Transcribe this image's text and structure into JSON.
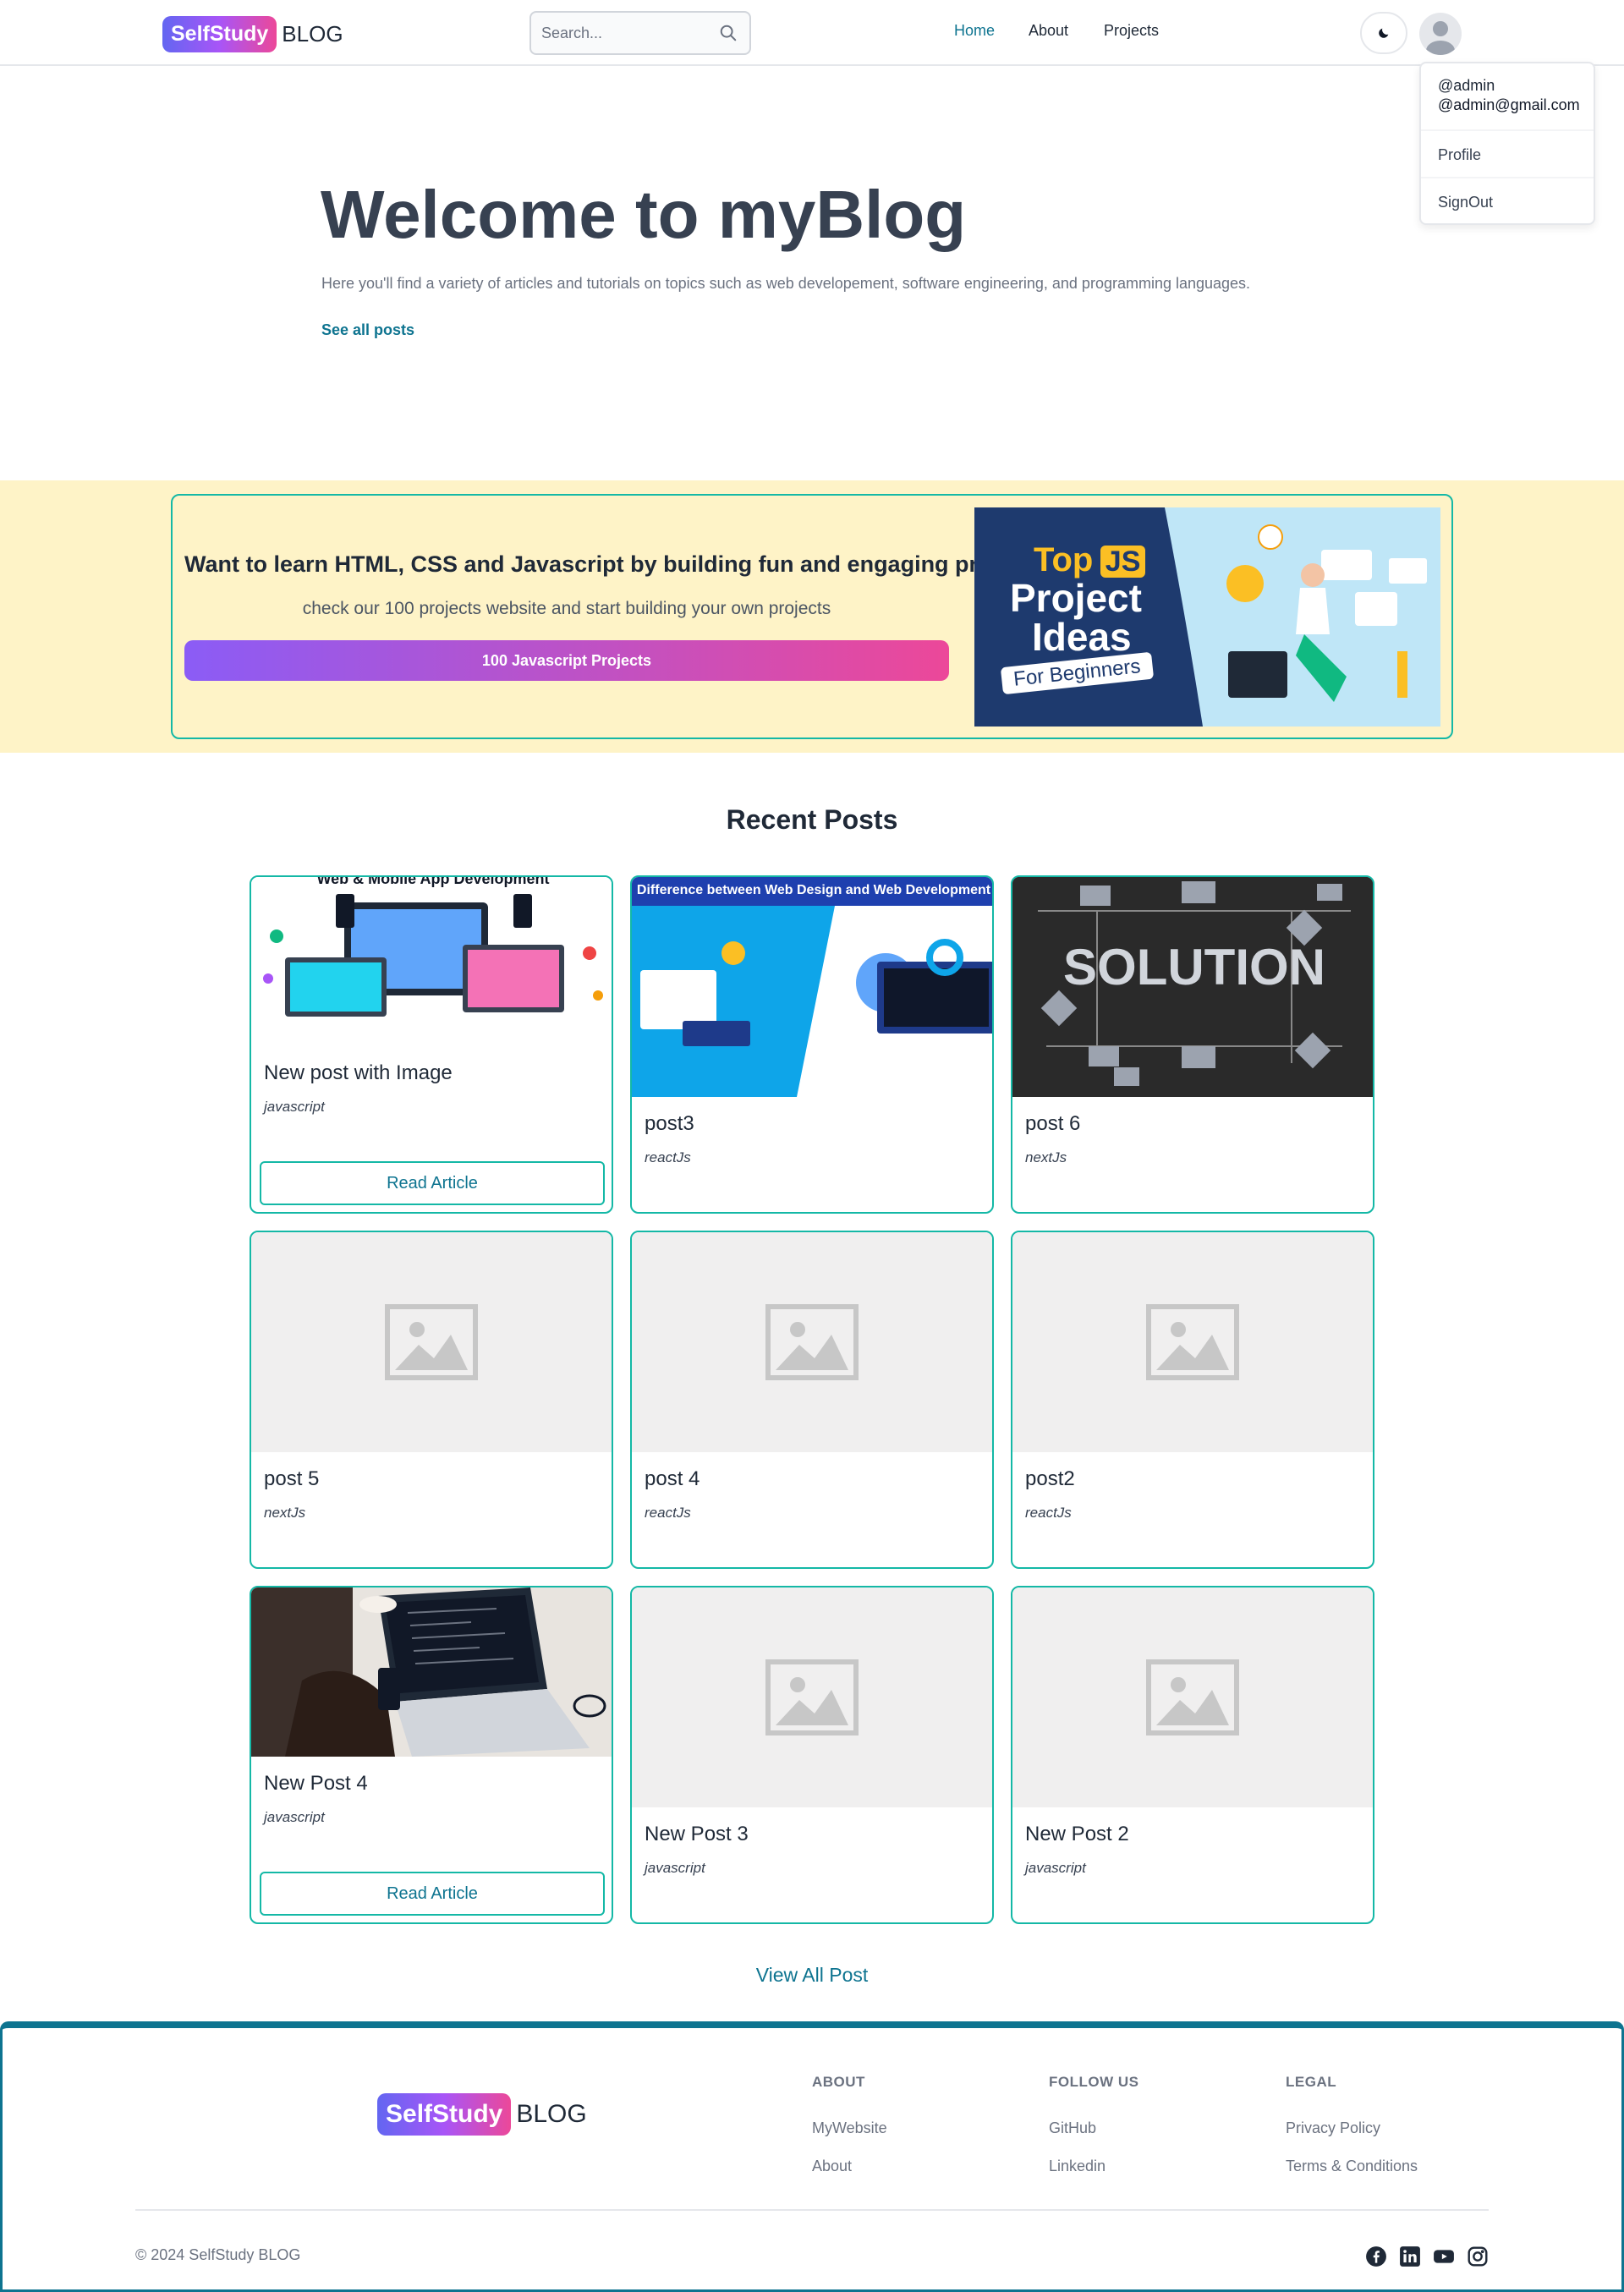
{
  "header": {
    "logo_badge": "SelfStudy",
    "logo_text": "BLOG",
    "search_placeholder": "Search...",
    "nav": [
      {
        "label": "Home",
        "active": true
      },
      {
        "label": "About",
        "active": false
      },
      {
        "label": "Projects",
        "active": false
      }
    ],
    "theme_icon": "moon-icon",
    "avatar_icon": "user-avatar-icon"
  },
  "user_menu": {
    "username": "@admin",
    "email": "@admin@gmail.com",
    "items": [
      "Profile",
      "SignOut"
    ]
  },
  "hero": {
    "title": "Welcome to myBlog",
    "subtitle": "Here you'll find a variety of articles and tutorials on topics such as web developement, software engineering, and programming languages.",
    "link": "See all posts"
  },
  "promo": {
    "title": "Want to learn HTML, CSS and Javascript by building fun and engaging projects?",
    "subtitle": "check our 100 projects website and start building your own projects",
    "button": "100 Javascript Projects",
    "image_text": {
      "top": "Top",
      "js": "JS",
      "line1": "Project",
      "line2": "Ideas",
      "line3": "For Beginners"
    }
  },
  "recent": {
    "title": "Recent Posts",
    "read_label": "Read Article",
    "posts": [
      {
        "title": "New post with Image",
        "category": "javascript",
        "image": "devices-illustration",
        "image_caption": "Web & Mobile App Development"
      },
      {
        "title": "post3",
        "category": "reactJs",
        "image": "web-design-illustration",
        "image_caption": "Difference between Web Design and Web Development"
      },
      {
        "title": "post 6",
        "category": "nextJs",
        "image": "chalkboard-solution",
        "image_caption": "SOLUTION"
      },
      {
        "title": "post 5",
        "category": "nextJs",
        "image": "placeholder"
      },
      {
        "title": "post 4",
        "category": "reactJs",
        "image": "placeholder"
      },
      {
        "title": "post2",
        "category": "reactJs",
        "image": "placeholder"
      },
      {
        "title": "New Post 4",
        "category": "javascript",
        "image": "laptop-photo"
      },
      {
        "title": "New Post 3",
        "category": "javascript",
        "image": "placeholder"
      },
      {
        "title": "New Post 2",
        "category": "javascript",
        "image": "placeholder"
      }
    ],
    "view_all": "View All Post"
  },
  "footer": {
    "logo_badge": "SelfStudy",
    "logo_text": "BLOG",
    "columns": [
      {
        "heading": "ABOUT",
        "links": [
          "MyWebsite",
          "About"
        ]
      },
      {
        "heading": "FOLLOW US",
        "links": [
          "GitHub",
          "Linkedin"
        ]
      },
      {
        "heading": "LEGAL",
        "links": [
          "Privacy Policy",
          "Terms & Conditions"
        ]
      }
    ],
    "copyright": "© 2024 SelfStudy BLOG",
    "social_icons": [
      "facebook-icon",
      "linkedin-icon",
      "youtube-icon",
      "instagram-icon"
    ]
  },
  "colors": {
    "accent": "#0e7490",
    "border_teal": "#14b8a6",
    "promo_bg": "#fef3c7",
    "gradient_start": "#8b5cf6",
    "gradient_end": "#ec4899"
  }
}
